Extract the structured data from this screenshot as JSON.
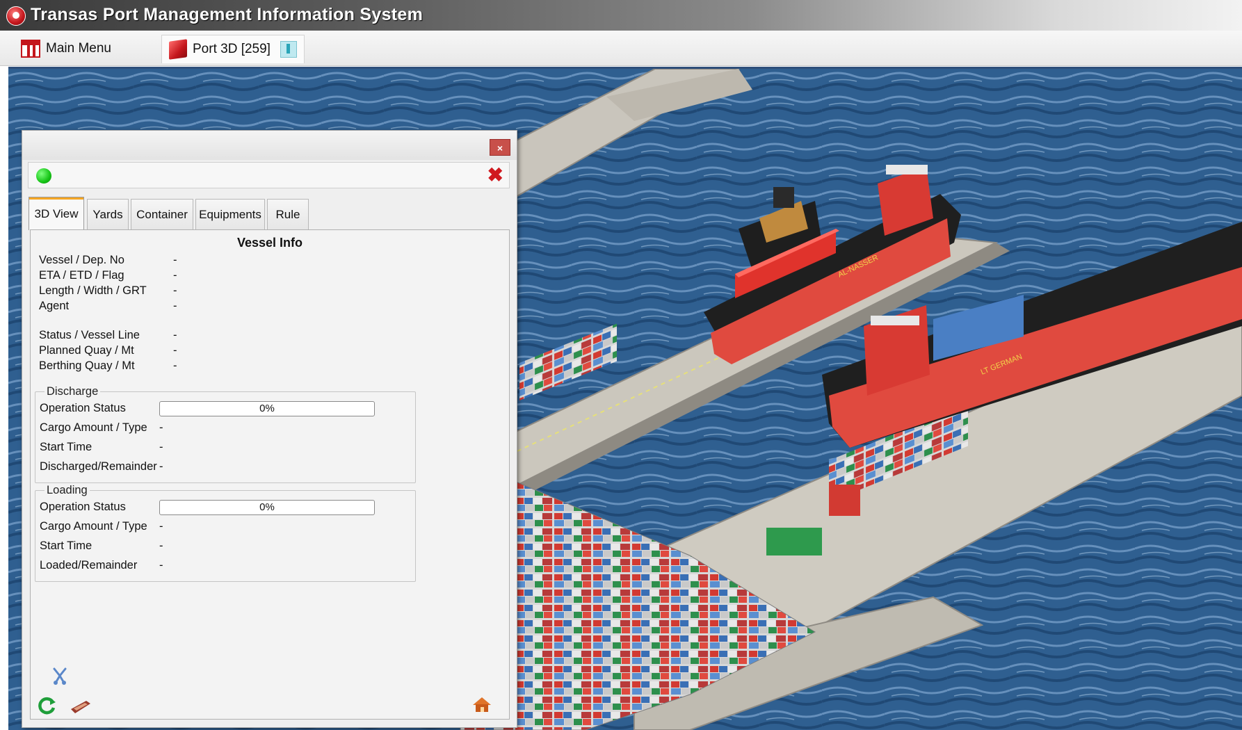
{
  "window": {
    "title": "Transas Port Management Information System"
  },
  "tabstrip": {
    "tabs": [
      {
        "label": "Main Menu",
        "icon": "main-menu-icon"
      },
      {
        "label": "Port 3D [259]",
        "icon": "cube-icon",
        "active": true
      }
    ]
  },
  "colors": {
    "accent_red": "#c4161c",
    "status_green": "#16c416",
    "water": "#2d5c8c"
  },
  "panel": {
    "status_indicator": "green",
    "close_glyph": "×",
    "status_close_glyph": "✖",
    "tabs": [
      "3D View",
      "Yards",
      "Container",
      "Equipments",
      "Rule"
    ],
    "active_tab": "3D View",
    "vessel_info": {
      "title": "Vessel Info",
      "rows": [
        {
          "label": "Vessel / Dep. No",
          "value": "-"
        },
        {
          "label": "ETA / ETD / Flag",
          "value": "-"
        },
        {
          "label": "Length / Width / GRT",
          "value": "-"
        },
        {
          "label": "Agent",
          "value": "-"
        },
        {
          "label": "Status / Vessel Line",
          "value": "-"
        },
        {
          "label": "Planned Quay / Mt",
          "value": "-"
        },
        {
          "label": "Berthing Quay / Mt",
          "value": "-"
        }
      ]
    },
    "discharge": {
      "title": "Discharge",
      "operation_status_label": "Operation Status",
      "operation_progress": 0,
      "operation_progress_text": "0%",
      "rows": [
        {
          "label": "Cargo Amount / Type",
          "value": "-"
        },
        {
          "label": "Start Time",
          "value": "-"
        },
        {
          "label": "Discharged/Remainder",
          "value": "-"
        }
      ]
    },
    "loading": {
      "title": "Loading",
      "operation_status_label": "Operation Status",
      "operation_progress": 0,
      "operation_progress_text": "0%",
      "rows": [
        {
          "label": "Cargo Amount / Type",
          "value": "-"
        },
        {
          "label": "Start Time",
          "value": "-"
        },
        {
          "label": "Loaded/Remainder",
          "value": "-"
        }
      ]
    },
    "toolbar_icons": [
      "wrench-icon",
      "refresh-icon",
      "ship-icon",
      "home-icon"
    ]
  },
  "scene": {
    "ship_names": [
      "AL-NASSER",
      "LT GERMAN"
    ]
  }
}
